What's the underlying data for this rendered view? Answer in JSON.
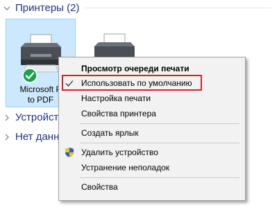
{
  "groups": {
    "printers": {
      "title": "Принтеры (2)"
    },
    "devices": {
      "title": "Устройств"
    },
    "no_data": {
      "title": "Нет данны"
    }
  },
  "devices": [
    {
      "label_line1": "Microsoft P",
      "label_line2": "to PDF",
      "selected": true,
      "default": true
    },
    {
      "label_line1": "",
      "label_line2": "",
      "selected": false,
      "default": false
    }
  ],
  "context_menu": {
    "items": [
      {
        "label": "Просмотр очереди печати",
        "bold": true
      },
      {
        "label": "Использовать по умолчанию",
        "checked": true,
        "highlighted": true
      },
      {
        "label": "Настройка печати"
      },
      {
        "label": "Свойства принтера"
      },
      {
        "label": "Создать ярлык"
      },
      {
        "label": "Удалить устройство",
        "icon": "uac-shield-icon"
      },
      {
        "label": "Устранение неполадок"
      },
      {
        "label": "Свойства"
      }
    ]
  },
  "colors": {
    "group_header": "#1e3287",
    "selection_bg": "#cce8ff",
    "menu_bg": "#f2f2f2",
    "highlight_border": "#d81f2a",
    "default_badge": "#16a34a"
  }
}
